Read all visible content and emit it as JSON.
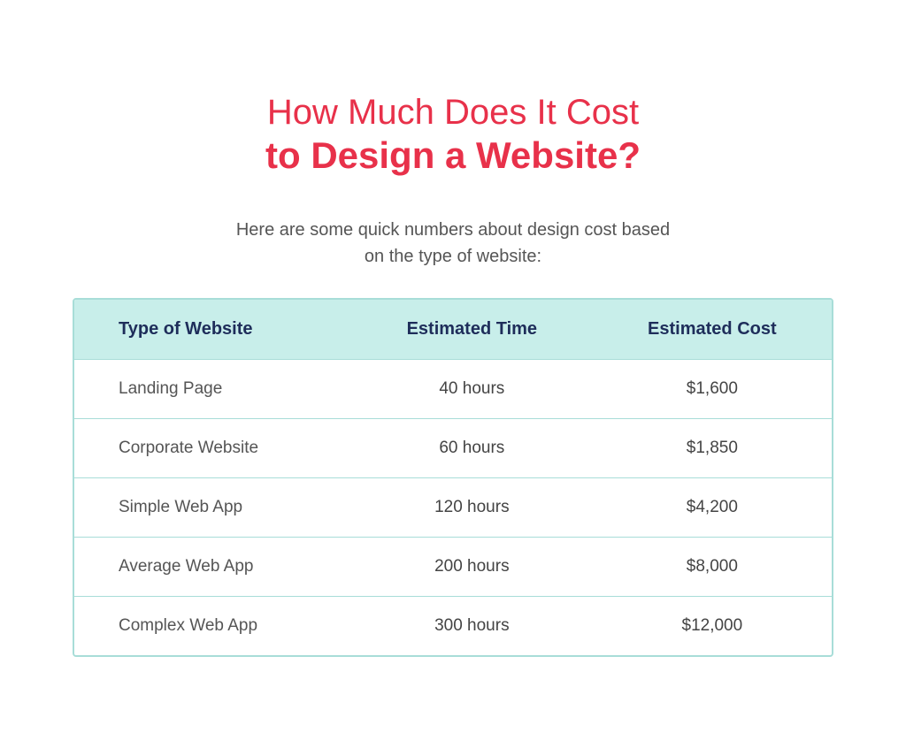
{
  "title": {
    "line1": "How Much Does It Cost",
    "line2": "to Design a Website?"
  },
  "subtitle": "Here are some quick numbers about design cost based\non the type of website:",
  "table": {
    "headers": {
      "col1": "Type of Website",
      "col2": "Estimated Time",
      "col3": "Estimated Cost"
    },
    "rows": [
      {
        "type": "Landing Page",
        "time": "40 hours",
        "cost": "$1,600"
      },
      {
        "type": "Corporate Website",
        "time": "60 hours",
        "cost": "$1,850"
      },
      {
        "type": "Simple Web App",
        "time": "120 hours",
        "cost": "$4,200"
      },
      {
        "type": "Average Web App",
        "time": "200 hours",
        "cost": "$8,000"
      },
      {
        "type": "Complex Web App",
        "time": "300 hours",
        "cost": "$12,000"
      }
    ]
  }
}
